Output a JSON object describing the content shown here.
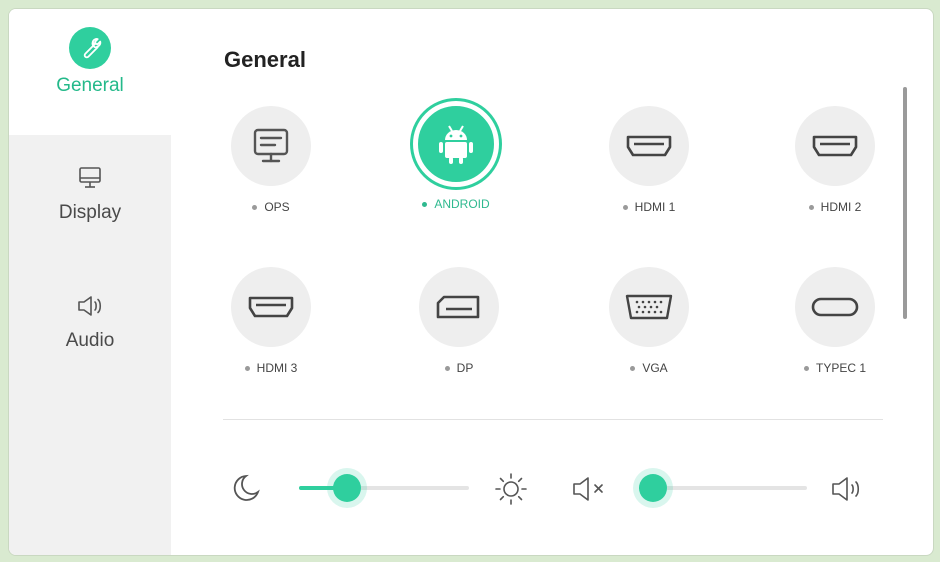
{
  "sidebar": {
    "items": [
      {
        "label": "General",
        "icon": "wrench-icon",
        "active": true
      },
      {
        "label": "Display",
        "icon": "monitor-icon",
        "active": false
      },
      {
        "label": "Audio",
        "icon": "speaker-icon",
        "active": false
      }
    ]
  },
  "main": {
    "title": "General",
    "sources": [
      {
        "label": "OPS",
        "icon": "ops-monitor-icon",
        "active": false
      },
      {
        "label": "ANDROID",
        "icon": "android-icon",
        "active": true
      },
      {
        "label": "HDMI 1",
        "icon": "hdmi-port-icon",
        "active": false
      },
      {
        "label": "HDMI 2",
        "icon": "hdmi-port-icon",
        "active": false
      },
      {
        "label": "HDMI 3",
        "icon": "hdmi-port-icon",
        "active": false
      },
      {
        "label": "DP",
        "icon": "displayport-icon",
        "active": false
      },
      {
        "label": "VGA",
        "icon": "vga-port-icon",
        "active": false
      },
      {
        "label": "TYPEC 1",
        "icon": "usb-c-port-icon",
        "active": false
      }
    ],
    "brightness": {
      "icon_low": "moon-icon",
      "icon_high": "sun-icon",
      "value_fraction": 0.2
    },
    "volume": {
      "icon_low": "mute-icon",
      "icon_high": "speaker-icon",
      "value_fraction": 0.0
    }
  },
  "colors": {
    "accent": "#2fcf9e",
    "sidebar_bg": "#f1f1f1",
    "icon_bg": "#eeeeee"
  }
}
